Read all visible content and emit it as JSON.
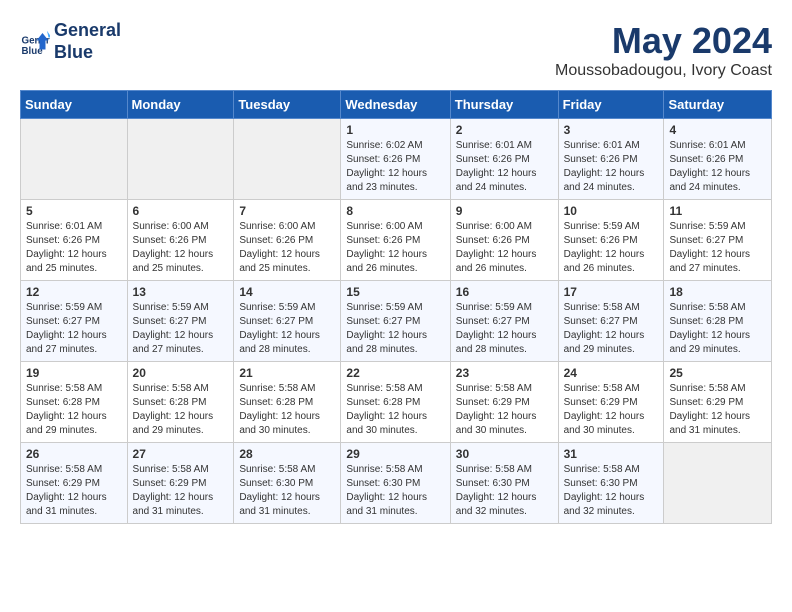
{
  "header": {
    "logo_line1": "General",
    "logo_line2": "Blue",
    "title": "May 2024",
    "subtitle": "Moussobadougou, Ivory Coast"
  },
  "calendar": {
    "weekdays": [
      "Sunday",
      "Monday",
      "Tuesday",
      "Wednesday",
      "Thursday",
      "Friday",
      "Saturday"
    ],
    "weeks": [
      [
        {
          "day": "",
          "info": ""
        },
        {
          "day": "",
          "info": ""
        },
        {
          "day": "",
          "info": ""
        },
        {
          "day": "1",
          "info": "Sunrise: 6:02 AM\nSunset: 6:26 PM\nDaylight: 12 hours\nand 23 minutes."
        },
        {
          "day": "2",
          "info": "Sunrise: 6:01 AM\nSunset: 6:26 PM\nDaylight: 12 hours\nand 24 minutes."
        },
        {
          "day": "3",
          "info": "Sunrise: 6:01 AM\nSunset: 6:26 PM\nDaylight: 12 hours\nand 24 minutes."
        },
        {
          "day": "4",
          "info": "Sunrise: 6:01 AM\nSunset: 6:26 PM\nDaylight: 12 hours\nand 24 minutes."
        }
      ],
      [
        {
          "day": "5",
          "info": "Sunrise: 6:01 AM\nSunset: 6:26 PM\nDaylight: 12 hours\nand 25 minutes."
        },
        {
          "day": "6",
          "info": "Sunrise: 6:00 AM\nSunset: 6:26 PM\nDaylight: 12 hours\nand 25 minutes."
        },
        {
          "day": "7",
          "info": "Sunrise: 6:00 AM\nSunset: 6:26 PM\nDaylight: 12 hours\nand 25 minutes."
        },
        {
          "day": "8",
          "info": "Sunrise: 6:00 AM\nSunset: 6:26 PM\nDaylight: 12 hours\nand 26 minutes."
        },
        {
          "day": "9",
          "info": "Sunrise: 6:00 AM\nSunset: 6:26 PM\nDaylight: 12 hours\nand 26 minutes."
        },
        {
          "day": "10",
          "info": "Sunrise: 5:59 AM\nSunset: 6:26 PM\nDaylight: 12 hours\nand 26 minutes."
        },
        {
          "day": "11",
          "info": "Sunrise: 5:59 AM\nSunset: 6:27 PM\nDaylight: 12 hours\nand 27 minutes."
        }
      ],
      [
        {
          "day": "12",
          "info": "Sunrise: 5:59 AM\nSunset: 6:27 PM\nDaylight: 12 hours\nand 27 minutes."
        },
        {
          "day": "13",
          "info": "Sunrise: 5:59 AM\nSunset: 6:27 PM\nDaylight: 12 hours\nand 27 minutes."
        },
        {
          "day": "14",
          "info": "Sunrise: 5:59 AM\nSunset: 6:27 PM\nDaylight: 12 hours\nand 28 minutes."
        },
        {
          "day": "15",
          "info": "Sunrise: 5:59 AM\nSunset: 6:27 PM\nDaylight: 12 hours\nand 28 minutes."
        },
        {
          "day": "16",
          "info": "Sunrise: 5:59 AM\nSunset: 6:27 PM\nDaylight: 12 hours\nand 28 minutes."
        },
        {
          "day": "17",
          "info": "Sunrise: 5:58 AM\nSunset: 6:27 PM\nDaylight: 12 hours\nand 29 minutes."
        },
        {
          "day": "18",
          "info": "Sunrise: 5:58 AM\nSunset: 6:28 PM\nDaylight: 12 hours\nand 29 minutes."
        }
      ],
      [
        {
          "day": "19",
          "info": "Sunrise: 5:58 AM\nSunset: 6:28 PM\nDaylight: 12 hours\nand 29 minutes."
        },
        {
          "day": "20",
          "info": "Sunrise: 5:58 AM\nSunset: 6:28 PM\nDaylight: 12 hours\nand 29 minutes."
        },
        {
          "day": "21",
          "info": "Sunrise: 5:58 AM\nSunset: 6:28 PM\nDaylight: 12 hours\nand 30 minutes."
        },
        {
          "day": "22",
          "info": "Sunrise: 5:58 AM\nSunset: 6:28 PM\nDaylight: 12 hours\nand 30 minutes."
        },
        {
          "day": "23",
          "info": "Sunrise: 5:58 AM\nSunset: 6:29 PM\nDaylight: 12 hours\nand 30 minutes."
        },
        {
          "day": "24",
          "info": "Sunrise: 5:58 AM\nSunset: 6:29 PM\nDaylight: 12 hours\nand 30 minutes."
        },
        {
          "day": "25",
          "info": "Sunrise: 5:58 AM\nSunset: 6:29 PM\nDaylight: 12 hours\nand 31 minutes."
        }
      ],
      [
        {
          "day": "26",
          "info": "Sunrise: 5:58 AM\nSunset: 6:29 PM\nDaylight: 12 hours\nand 31 minutes."
        },
        {
          "day": "27",
          "info": "Sunrise: 5:58 AM\nSunset: 6:29 PM\nDaylight: 12 hours\nand 31 minutes."
        },
        {
          "day": "28",
          "info": "Sunrise: 5:58 AM\nSunset: 6:30 PM\nDaylight: 12 hours\nand 31 minutes."
        },
        {
          "day": "29",
          "info": "Sunrise: 5:58 AM\nSunset: 6:30 PM\nDaylight: 12 hours\nand 31 minutes."
        },
        {
          "day": "30",
          "info": "Sunrise: 5:58 AM\nSunset: 6:30 PM\nDaylight: 12 hours\nand 32 minutes."
        },
        {
          "day": "31",
          "info": "Sunrise: 5:58 AM\nSunset: 6:30 PM\nDaylight: 12 hours\nand 32 minutes."
        },
        {
          "day": "",
          "info": ""
        }
      ]
    ]
  }
}
